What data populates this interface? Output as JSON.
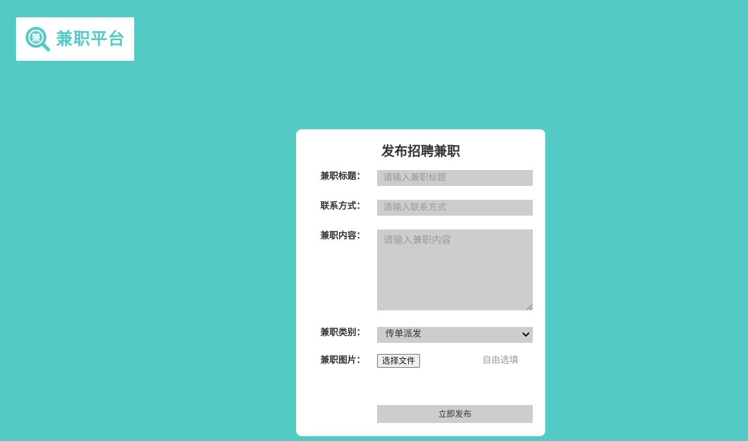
{
  "header": {
    "logo_glyph": "兼",
    "logo_text": "兼职平台",
    "logo_icon": "magnifier-badge-icon",
    "brand_color": "#53cbc4"
  },
  "form": {
    "title": "发布招聘兼职",
    "title_field": {
      "label": "兼职标题：",
      "value": "",
      "placeholder": "请输入兼职标题"
    },
    "contact_field": {
      "label": "联系方式：",
      "value": "",
      "placeholder": "请输入联系方式"
    },
    "content_field": {
      "label": "兼职内容：",
      "value": "",
      "placeholder": "请输入兼职内容"
    },
    "category_field": {
      "label": "兼职类别：",
      "selected": "传单派发",
      "icon": "chevron-down-icon"
    },
    "image_field": {
      "label": "兼职图片：",
      "button_label": "选择文件",
      "hint": "自由选填"
    },
    "submit_label": "立即发布"
  }
}
